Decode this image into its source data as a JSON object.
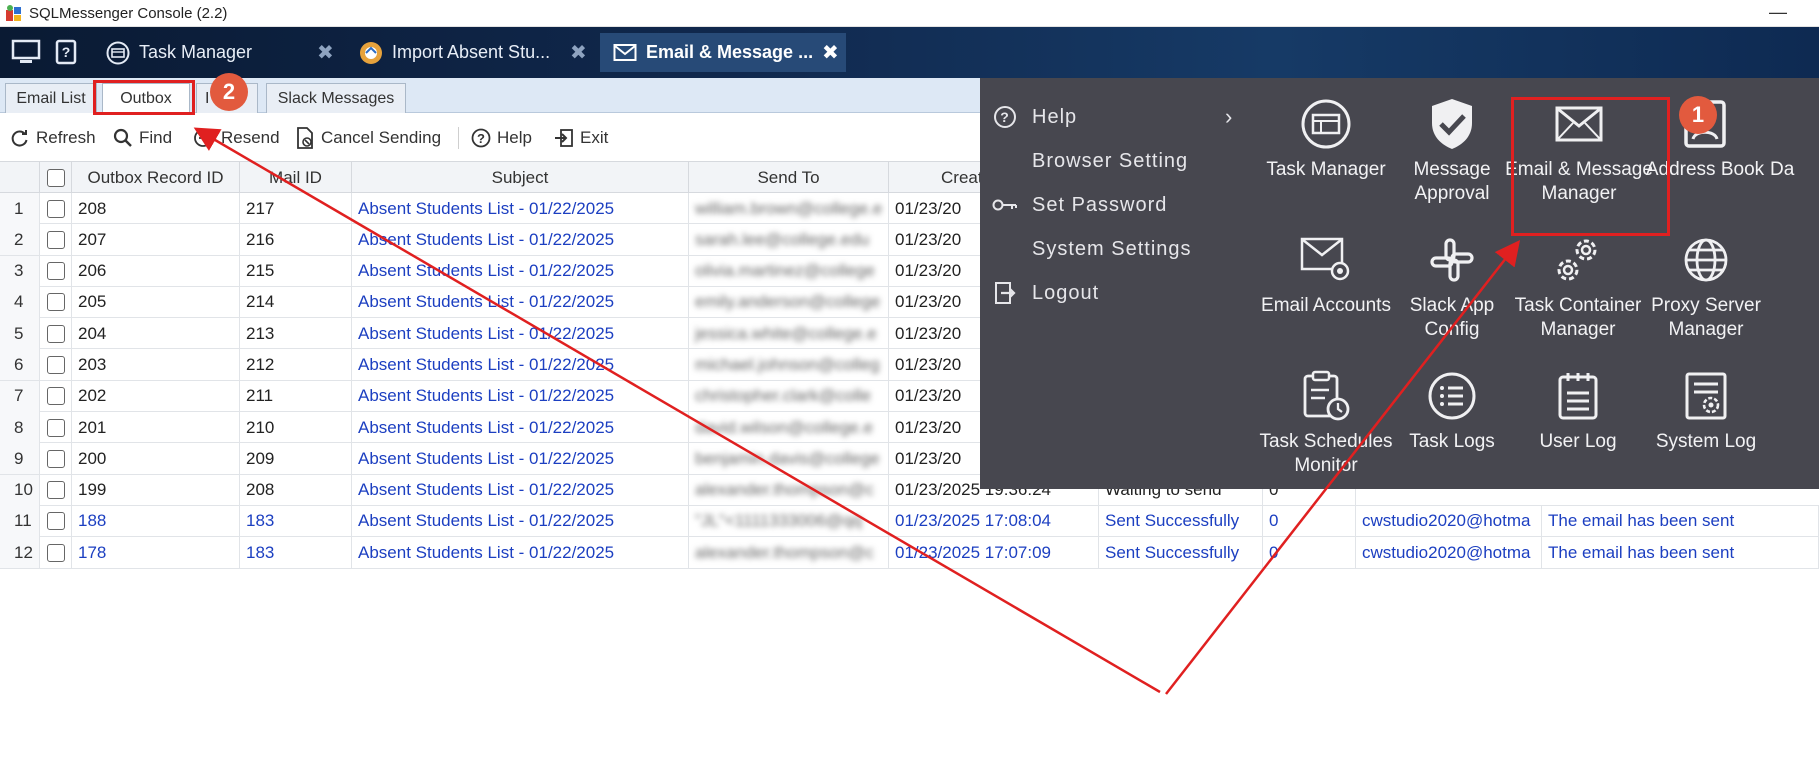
{
  "window": {
    "title": "SQLMessenger Console (2.2)",
    "minimize_glyph": "—"
  },
  "tabs": [
    {
      "label": "Task Manager",
      "icon": "task-manager-icon",
      "close": "✖"
    },
    {
      "label": "Import Absent Stu...",
      "icon": "import-icon",
      "close": "✖"
    },
    {
      "label": "Email & Message ...",
      "icon": "envelope-icon",
      "close": "✖",
      "active": true
    }
  ],
  "subtabs": [
    {
      "label": "Email List"
    },
    {
      "label": "Outbox",
      "active": true
    },
    {
      "label": "I"
    },
    {
      "label": "Slack Messages"
    }
  ],
  "toolbar": {
    "refresh": "Refresh",
    "find": "Find",
    "resend": "Resend",
    "cancel_sending": "Cancel Sending",
    "help": "Help",
    "exit": "Exit"
  },
  "grid": {
    "headers": {
      "outbox_record_id": "Outbox Record ID",
      "mail_id": "Mail ID",
      "subject": "Subject",
      "send_to": "Send To",
      "created": "Creat"
    },
    "rows": [
      {
        "n": "1",
        "outbox": "208",
        "mail": "217",
        "subject": "Absent Students List - 01/22/2025",
        "to": "william.brown@college.e",
        "created": "01/23/20"
      },
      {
        "n": "2",
        "outbox": "207",
        "mail": "216",
        "subject": "Absent Students List - 01/22/2025",
        "to": "sarah.lee@college.edu",
        "created": "01/23/20"
      },
      {
        "n": "3",
        "outbox": "206",
        "mail": "215",
        "subject": "Absent Students List - 01/22/2025",
        "to": "olivia.martinez@college",
        "created": "01/23/20"
      },
      {
        "n": "4",
        "outbox": "205",
        "mail": "214",
        "subject": "Absent Students List - 01/22/2025",
        "to": "emily.anderson@college",
        "created": "01/23/20"
      },
      {
        "n": "5",
        "outbox": "204",
        "mail": "213",
        "subject": "Absent Students List - 01/22/2025",
        "to": "jessica.white@college.e",
        "created": "01/23/20"
      },
      {
        "n": "6",
        "outbox": "203",
        "mail": "212",
        "subject": "Absent Students List - 01/22/2025",
        "to": "michael.johnson@colleg",
        "created": "01/23/20"
      },
      {
        "n": "7",
        "outbox": "202",
        "mail": "211",
        "subject": "Absent Students List - 01/22/2025",
        "to": "christopher.clark@colle",
        "created": "01/23/20"
      },
      {
        "n": "8",
        "outbox": "201",
        "mail": "210",
        "subject": "Absent Students List - 01/22/2025",
        "to": "david.wilson@college.e",
        "created": "01/23/20"
      },
      {
        "n": "9",
        "outbox": "200",
        "mail": "209",
        "subject": "Absent Students List - 01/22/2025",
        "to": "benjamin.davis@college",
        "created": "01/23/20"
      },
      {
        "n": "10",
        "outbox": "199",
        "mail": "208",
        "subject": "Absent Students List - 01/22/2025",
        "to": "alexander.thompson@c",
        "created": "01/23/2025 19:36:24",
        "status": "Waiting to send",
        "count": "0"
      },
      {
        "n": "11",
        "outbox": "188",
        "mail": "183",
        "subject": "Absent Students List - 01/22/2025",
        "to": "\"JL\"<1111333006@qq",
        "created": "01/23/2025 17:08:04",
        "status": "Sent Successfully",
        "count": "0",
        "account": "cwstudio2020@hotma",
        "result": "The email has been sent",
        "sent_row": true
      },
      {
        "n": "12",
        "outbox": "178",
        "mail": "183",
        "subject": "Absent Students List - 01/22/2025",
        "to": "alexander.thompson@c",
        "created": "01/23/2025 17:07:09",
        "status": "Sent Successfully",
        "count": "0",
        "account": "cwstudio2020@hotma",
        "result": "The email has been sent",
        "sent_row": true
      }
    ]
  },
  "menu": {
    "left_items": [
      {
        "label": "Help",
        "icon": "help-circle-icon",
        "has_submenu": true
      },
      {
        "label": "Browser Setting",
        "icon": ""
      },
      {
        "label": "Set Password",
        "icon": "key-icon"
      },
      {
        "label": "System Settings",
        "icon": ""
      },
      {
        "label": "Logout",
        "icon": "logout-icon"
      }
    ],
    "chevron": "›",
    "apps": [
      {
        "label": "Task Manager",
        "icon": "task-manager-icon"
      },
      {
        "label": "Message Approval",
        "icon": "shield-check-icon"
      },
      {
        "label": "Email & Message Manager",
        "icon": "envelope-icon"
      },
      {
        "label": "Address Book",
        "icon": "address-book-icon"
      },
      {
        "label": "Da",
        "icon": ""
      },
      {
        "label": "Email Accounts",
        "icon": "email-gear-icon"
      },
      {
        "label": "Slack App Config",
        "icon": "slack-icon"
      },
      {
        "label": "Task Container Manager",
        "icon": "gears-icon"
      },
      {
        "label": "Proxy Server Manager",
        "icon": "globe-icon"
      },
      {
        "label": "Task Schedules Monitor",
        "icon": "clipboard-clock-icon"
      },
      {
        "label": "Task Logs",
        "icon": "list-icon"
      },
      {
        "label": "User Log",
        "icon": "notepad-icon"
      },
      {
        "label": "System Log",
        "icon": "document-gear-icon"
      }
    ]
  },
  "annotations": {
    "badge1": "1",
    "badge2": "2",
    "color": "#e02020"
  }
}
